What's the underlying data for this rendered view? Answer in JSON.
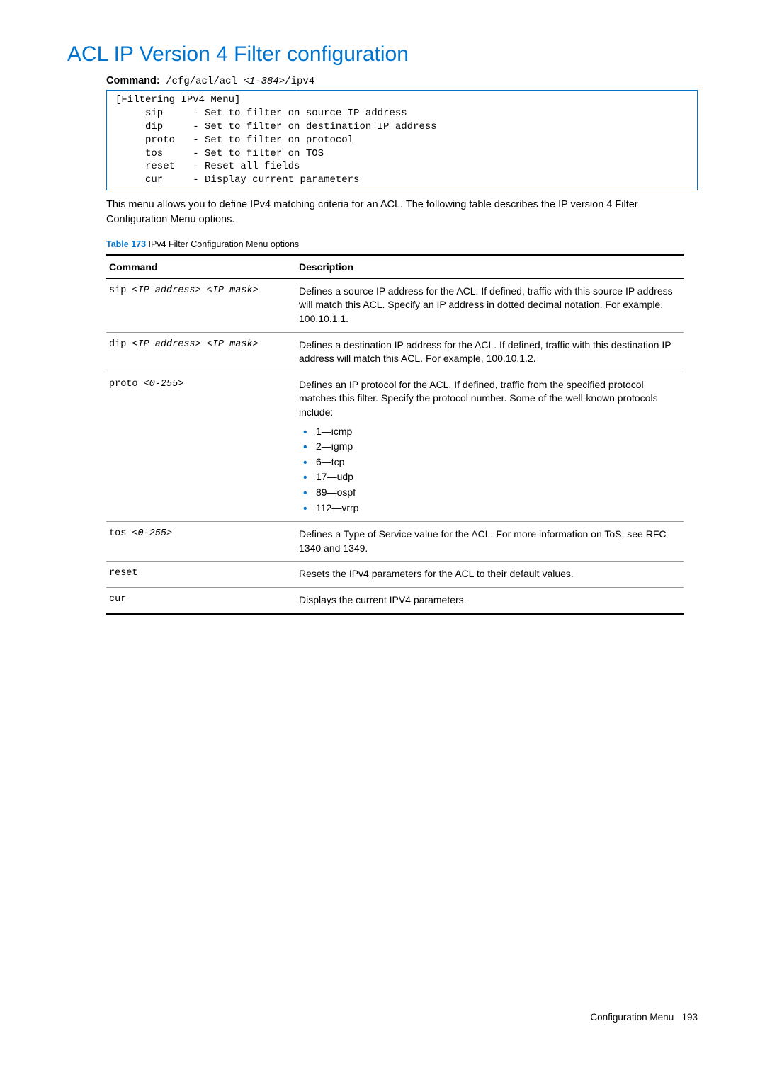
{
  "title": "ACL IP Version 4 Filter configuration",
  "command_label": "Command:",
  "command_prefix": " /cfg/acl/acl ",
  "command_range": "<1-384>",
  "command_suffix": "/ipv4",
  "menu_text": "[Filtering IPv4 Menu]\n     sip     - Set to filter on source IP address\n     dip     - Set to filter on destination IP address\n     proto   - Set to filter on protocol\n     tos     - Set to filter on TOS\n     reset   - Reset all fields\n     cur     - Display current parameters",
  "intro": "This menu allows you to define IPv4 matching criteria for an ACL. The following table describes the IP version 4 Filter Configuration Menu options.",
  "table_num": "Table 173",
  "table_title": " IPv4 Filter Configuration Menu options",
  "columns": {
    "cmd": "Command",
    "desc": "Description"
  },
  "rows": {
    "sip": {
      "cmd_parts": [
        "sip ",
        "<IP address>",
        " ",
        "<IP mask>"
      ],
      "desc": "Defines a source IP address for the ACL. If defined, traffic with this source IP address will match this ACL. Specify an IP address in dotted decimal notation. For example, 100.10.1.1."
    },
    "dip": {
      "cmd_parts": [
        "dip ",
        "<IP address>",
        " ",
        "<IP mask>"
      ],
      "desc": "Defines a destination IP address for the ACL. If defined, traffic with this destination IP address will match this ACL. For example, 100.10.1.2."
    },
    "proto": {
      "cmd_parts": [
        "proto ",
        "<0-255>"
      ],
      "desc": "Defines an IP protocol for the ACL. If defined, traffic from the specified protocol matches this filter. Specify the protocol number. Some of the well-known protocols include:",
      "list": [
        "1—icmp",
        "2—igmp",
        "6—tcp",
        "17—udp",
        "89—ospf",
        "112—vrrp"
      ]
    },
    "tos": {
      "cmd_parts": [
        "tos ",
        "<0-255>"
      ],
      "desc": "Defines a Type of Service value for the ACL. For more information on ToS, see RFC 1340 and 1349."
    },
    "reset": {
      "cmd_parts": [
        "reset"
      ],
      "desc": "Resets the IPv4 parameters for the ACL to their default values."
    },
    "cur": {
      "cmd_parts": [
        "cur"
      ],
      "desc": "Displays the current IPV4 parameters."
    }
  },
  "footer_label": "Configuration Menu",
  "footer_page": "193"
}
